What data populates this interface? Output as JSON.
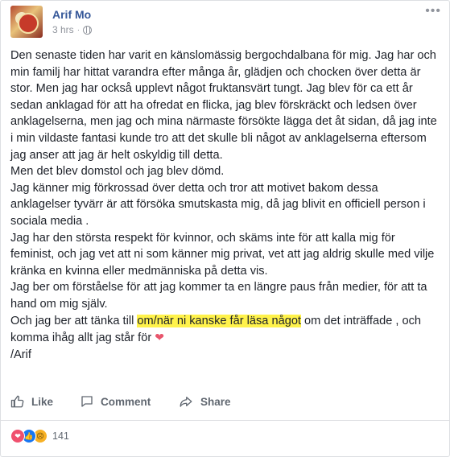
{
  "header": {
    "author": "Arif Mo",
    "time": "3 hrs",
    "separator": "·",
    "more": "•••"
  },
  "post": {
    "paragraphs": [
      "Den senaste tiden har varit en känslomässig bergochdalbana för mig. Jag har och min familj har hittat varandra efter många år, glädjen och chocken över detta är stor. Men jag har också upplevt något fruktansvärt tungt. Jag blev för ca ett år sedan anklagad för att ha ofredat en flicka, jag blev förskräckt och ledsen över anklagelserna, men jag och mina närmaste försökte lägga det åt sidan, då jag inte i min vildaste fantasi kunde tro att det skulle bli något av anklagelserna eftersom jag anser att jag är helt oskyldig till detta.",
      "Men det blev domstol och jag blev dömd.",
      "Jag känner mig förkrossad över detta och tror att motivet bakom dessa anklagelser tyvärr är att försöka smutskasta mig, då jag blivit en officiell person i sociala media .",
      "Jag har den största respekt för kvinnor, och skäms inte för att kalla mig för feminist, och jag vet att ni som känner mig privat, vet att jag aldrig skulle med vilje kränka en kvinna eller medmänniska på detta vis.",
      "Jag ber om förståelse för att jag kommer ta en längre paus från medier, för att ta hand om mig själv."
    ],
    "last_before": "Och jag ber att tänka till ",
    "last_highlight": "om/när ni kanske får läsa något",
    "last_after": " om det inträffade , och komma ihåg allt jag står för ",
    "heart": "❤",
    "signature": "/Arif"
  },
  "actions": {
    "like": "Like",
    "comment": "Comment",
    "share": "Share"
  },
  "reactions": {
    "count": "141",
    "types": [
      "love",
      "like",
      "sad"
    ]
  },
  "colors": {
    "author": "#365899",
    "highlight": "#fff24b",
    "action_text": "#606770"
  }
}
